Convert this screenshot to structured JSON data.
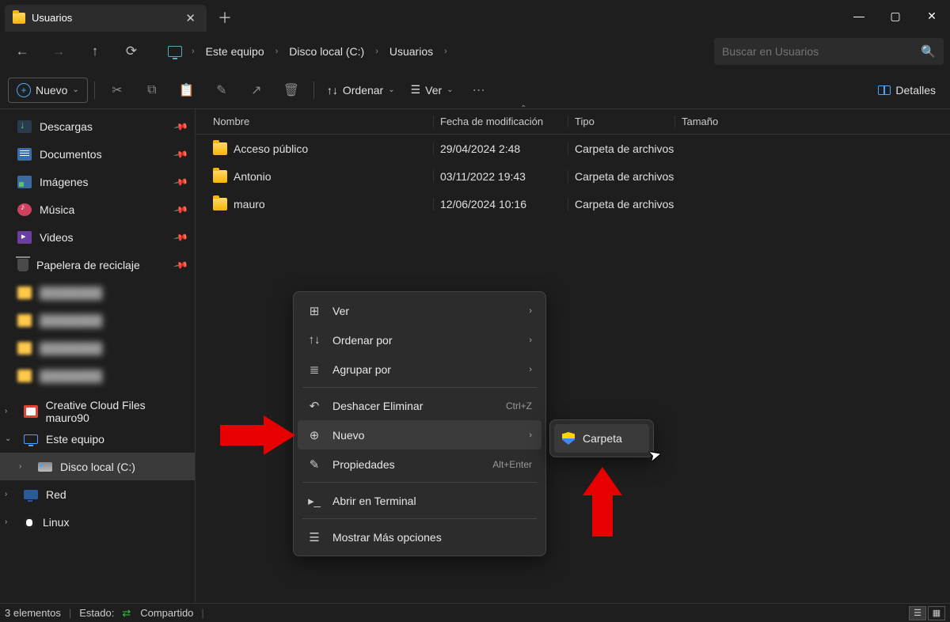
{
  "tab": {
    "title": "Usuarios"
  },
  "breadcrumb": [
    "Este equipo",
    "Disco local (C:)",
    "Usuarios"
  ],
  "search": {
    "placeholder": "Buscar en Usuarios"
  },
  "toolbar": {
    "new": "Nuevo",
    "sort": "Ordenar",
    "view": "Ver",
    "details": "Detalles"
  },
  "sidebar": {
    "quick": [
      {
        "icon": "dl",
        "label": "Descargas"
      },
      {
        "icon": "doc",
        "label": "Documentos"
      },
      {
        "icon": "img",
        "label": "Imágenes"
      },
      {
        "icon": "music",
        "label": "Música"
      },
      {
        "icon": "video",
        "label": "Videos"
      },
      {
        "icon": "trash",
        "label": "Papelera de reciclaje"
      }
    ],
    "blurred": [
      "item1",
      "item2",
      "item3",
      "item4"
    ],
    "tree": [
      {
        "icon": "cc",
        "label": "Creative Cloud Files  mauro90",
        "exp": "›"
      },
      {
        "icon": "monitor",
        "label": "Este equipo",
        "exp": "⌄"
      },
      {
        "icon": "disk",
        "label": "Disco local (C:)",
        "exp": "›",
        "indent": true,
        "selected": true
      },
      {
        "icon": "net",
        "label": "Red",
        "exp": "›"
      },
      {
        "icon": "penguin",
        "label": "Linux",
        "exp": "›"
      }
    ]
  },
  "columns": {
    "name": "Nombre",
    "date": "Fecha de modificación",
    "type": "Tipo",
    "size": "Tamaño"
  },
  "rows": [
    {
      "name": "Acceso público",
      "date": "29/04/2024 2:48",
      "type": "Carpeta de archivos"
    },
    {
      "name": "Antonio",
      "date": "03/11/2022 19:43",
      "type": "Carpeta de archivos"
    },
    {
      "name": "mauro",
      "date": "12/06/2024 10:16",
      "type": "Carpeta de archivos"
    }
  ],
  "context": [
    {
      "icon": "⊞",
      "label": "Ver",
      "sub": true
    },
    {
      "icon": "↑↓",
      "label": "Ordenar por",
      "sub": true
    },
    {
      "icon": "≣",
      "label": "Agrupar por",
      "sub": true
    },
    {
      "div": true
    },
    {
      "icon": "↶",
      "label": "Deshacer Eliminar",
      "shortcut": "Ctrl+Z"
    },
    {
      "icon": "⊕",
      "label": "Nuevo",
      "sub": true,
      "hl": true
    },
    {
      "icon": "✎",
      "label": "Propiedades",
      "shortcut": "Alt+Enter"
    },
    {
      "div": true
    },
    {
      "icon": "▸_",
      "label": "Abrir en Terminal"
    },
    {
      "div": true
    },
    {
      "icon": "☰",
      "label": "Mostrar Más opciones"
    }
  ],
  "submenu": {
    "label": "Carpeta"
  },
  "status": {
    "count": "3 elementos",
    "state_label": "Estado:",
    "state_value": "Compartido"
  }
}
